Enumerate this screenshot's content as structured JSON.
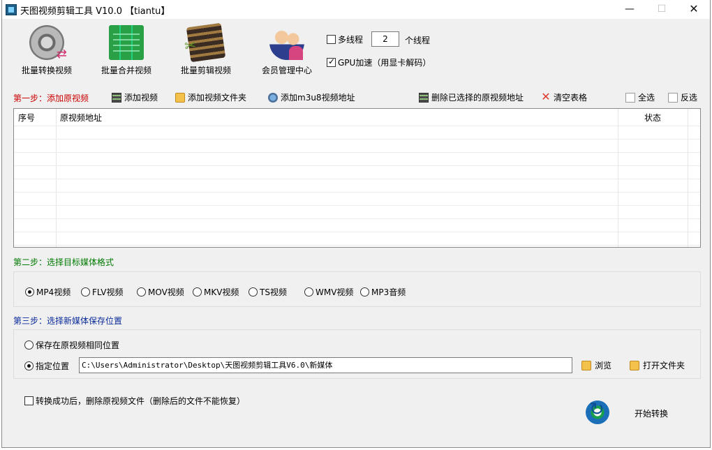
{
  "window": {
    "title": "天图视频剪辑工具 V10.0 【tiantu】",
    "controls": {
      "minimize": "—",
      "maximize": "☐",
      "close": "✕"
    }
  },
  "toolbar": {
    "buttons": [
      {
        "label": "批量转换视频",
        "icon": "film-reel-convert-icon"
      },
      {
        "label": "批量合并视频",
        "icon": "merge-grid-icon"
      },
      {
        "label": "批量剪辑视频",
        "icon": "film-cut-icon"
      },
      {
        "label": "会员管理中心",
        "icon": "users-icon"
      }
    ],
    "multithread": {
      "label": "多线程",
      "checked": false,
      "count": "2",
      "suffix": "个线程"
    },
    "gpu": {
      "label": "GPU加速（用显卡解码）",
      "checked": true
    }
  },
  "step1": {
    "label": "第一步：添加原视频",
    "color": "#cc0000",
    "actions": [
      {
        "label": "添加视频",
        "icon": "add-video-icon"
      },
      {
        "label": "添加视频文件夹",
        "icon": "folder-icon"
      },
      {
        "label": "添加m3u8视频地址",
        "icon": "network-icon"
      },
      {
        "label": "删除已选择的原视频地址",
        "icon": "delete-video-icon"
      },
      {
        "label": "清空表格",
        "icon": "clear-x-icon"
      },
      {
        "label": "全选",
        "icon": "document-icon"
      },
      {
        "label": "反选",
        "icon": "document-icon"
      }
    ],
    "table": {
      "columns": [
        "序号",
        "原视频地址",
        "状态"
      ],
      "rows": []
    }
  },
  "step2": {
    "label": "第二步：选择目标媒体格式",
    "color": "#007a00",
    "formats": [
      {
        "label": "MP4视频",
        "selected": true
      },
      {
        "label": "FLV视频",
        "selected": false
      },
      {
        "label": "MOV视频",
        "selected": false
      },
      {
        "label": "MKV视频",
        "selected": false
      },
      {
        "label": "TS视频",
        "selected": false
      },
      {
        "label": "WMV视频",
        "selected": false
      },
      {
        "label": "MP3音频",
        "selected": false
      }
    ]
  },
  "step3": {
    "label": "第三步：选择新媒体保存位置",
    "color": "#0a2a9a",
    "same_location": {
      "label": "保存在原视频相同位置",
      "selected": false
    },
    "custom_location": {
      "label": "指定位置",
      "selected": true
    },
    "path_value": "C:\\Users\\Administrator\\Desktop\\天图视频剪辑工具V6.0\\新媒体",
    "browse_label": "浏览",
    "open_folder_label": "打开文件夹"
  },
  "footer": {
    "delete_after": {
      "label": "转换成功后，删除原视频文件（删除后的文件不能恢复）",
      "checked": false
    },
    "start_label": "开始转换"
  }
}
